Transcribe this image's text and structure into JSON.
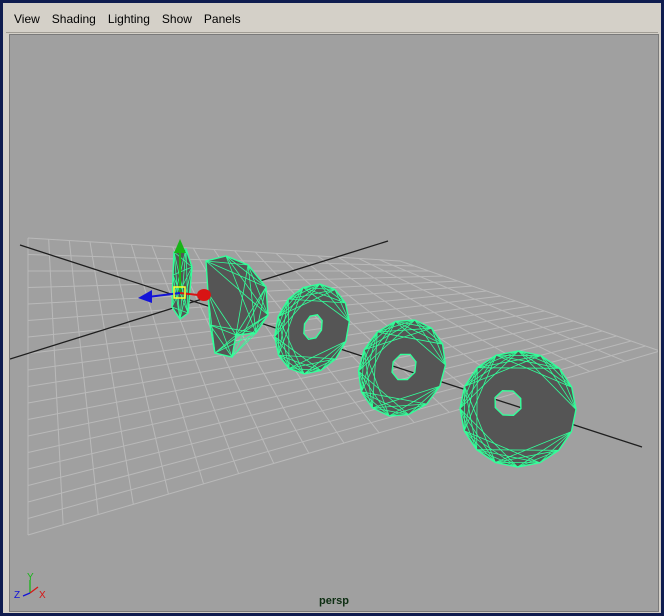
{
  "menubar": {
    "items": [
      "View",
      "Shading",
      "Lighting",
      "Show",
      "Panels"
    ]
  },
  "viewport": {
    "camera": "persp",
    "background_color": "#a0a0a0",
    "grid_color": "#b9b9b9",
    "mesh_color": "#555555",
    "wire_color": "#33ff9a",
    "axis_x_color": "#d81414",
    "axis_y_color": "#18b418",
    "axis_z_color": "#1414d8"
  },
  "view_axes": {
    "x_label": "X",
    "y_label": "Y",
    "z_label": "Z"
  }
}
